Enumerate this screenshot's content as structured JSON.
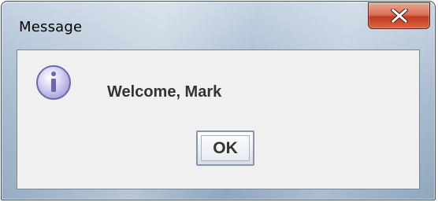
{
  "window": {
    "title": "Message",
    "close_glyph": "x"
  },
  "dialog": {
    "icon": "info-icon",
    "message": "Welcome, Mark",
    "ok_label": "OK"
  },
  "colors": {
    "close_button": "#c9452d",
    "icon_fill": "#c9c6ec",
    "icon_border": "#6b67a8",
    "client_bg": "#f0f0f0"
  }
}
